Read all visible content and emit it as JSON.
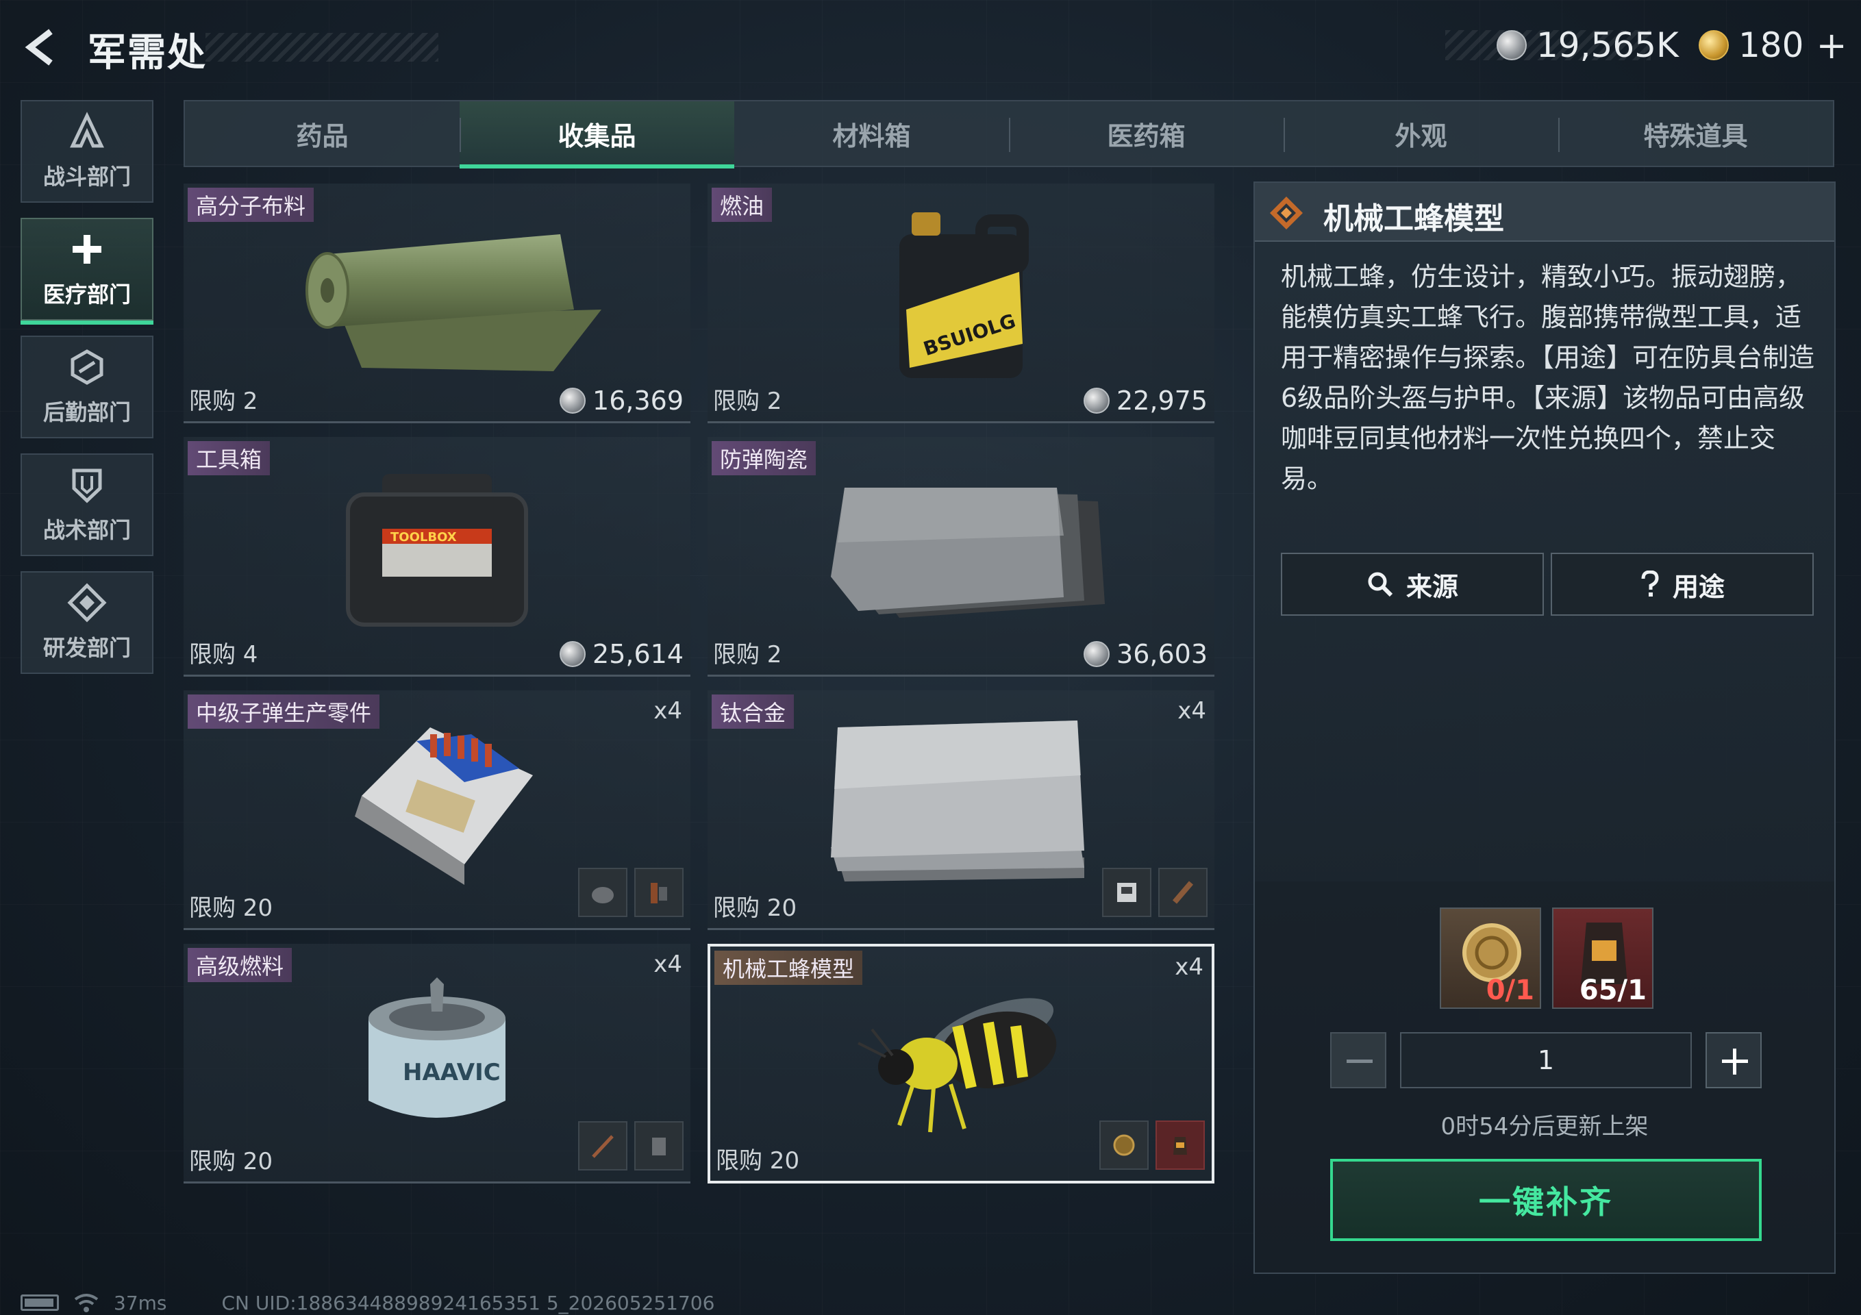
{
  "header": {
    "title": "军需处",
    "currency_silver": "19,565K",
    "currency_gold": "180",
    "currency_gold_plus": "+"
  },
  "sidebar": {
    "items": [
      {
        "label": "战斗部门",
        "icon": "combat-icon",
        "active": false
      },
      {
        "label": "医疗部门",
        "icon": "medical-cross-icon",
        "active": true
      },
      {
        "label": "后勤部门",
        "icon": "logistics-icon",
        "active": false
      },
      {
        "label": "战术部门",
        "icon": "shield-icon",
        "active": false
      },
      {
        "label": "研发部门",
        "icon": "research-icon",
        "active": false
      }
    ]
  },
  "tabs": [
    {
      "label": "药品",
      "active": false
    },
    {
      "label": "收集品",
      "active": true
    },
    {
      "label": "材料箱",
      "active": false
    },
    {
      "label": "医药箱",
      "active": false
    },
    {
      "label": "外观",
      "active": false
    },
    {
      "label": "特殊道具",
      "active": false
    }
  ],
  "items": [
    {
      "name": "高分子布料",
      "limit": "限购 2",
      "price": "16,369",
      "qty": "",
      "art": "fabric-roll"
    },
    {
      "name": "燃油",
      "limit": "限购 2",
      "price": "22,975",
      "qty": "",
      "art": "fuel-jug",
      "art_label": "BSUIOLG"
    },
    {
      "name": "工具箱",
      "limit": "限购 4",
      "price": "25,614",
      "qty": "",
      "art": "toolbox",
      "art_label": "TOOLBOX"
    },
    {
      "name": "防弹陶瓷",
      "limit": "限购 2",
      "price": "36,603",
      "qty": "",
      "art": "ceramic-plates"
    },
    {
      "name": "中级子弹生产零件",
      "limit": "限购 20",
      "price": "",
      "qty": "x4",
      "art": "ammo-kit"
    },
    {
      "name": "钛合金",
      "limit": "限购 20",
      "price": "",
      "qty": "x4",
      "art": "titanium-sheets"
    },
    {
      "name": "高级燃料",
      "limit": "限购 20",
      "price": "",
      "qty": "x4",
      "art": "fuel-can",
      "art_label": "HAAVIC"
    },
    {
      "name": "机械工蜂模型",
      "limit": "限购 20",
      "price": "",
      "qty": "x4",
      "art": "mech-bee",
      "selected": true
    }
  ],
  "detail": {
    "title": "机械工蜂模型",
    "description": "机械工蜂，仿生设计，精致小巧。振动翅膀，能模仿真实工蜂飞行。腹部携带微型工具，适用于精密操作与探索。【用途】可在防具台制造6级品阶头盔与护甲。【来源】该物品可由高级咖啡豆同其他材料一次性兑换四个，禁止交易。",
    "source_button": "来源",
    "use_button": "用途",
    "requirements": [
      {
        "count": "0/1",
        "short": true,
        "icon": "gold-coin-token-icon"
      },
      {
        "count": "65/1",
        "short": false,
        "icon": "coffee-bag-icon"
      }
    ],
    "quantity": "1",
    "restock_text": "0时54分后更新上架",
    "fill_button": "一键补齐"
  },
  "status": {
    "ping": "37ms",
    "uid": "CN UID:18863448898924165351 5_202605251706"
  },
  "colors": {
    "accent_green": "#3fd69a",
    "shortage_red": "#ff5a4f",
    "name_tag_purple": "#6a4d7a"
  }
}
